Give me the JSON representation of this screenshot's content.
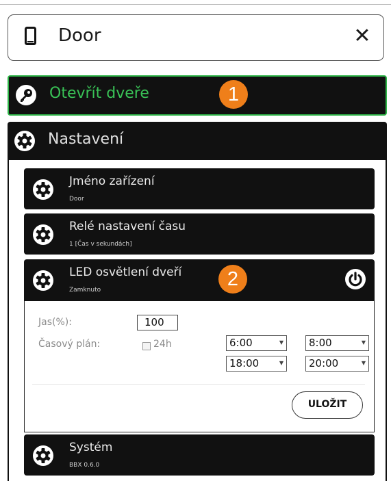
{
  "dialog": {
    "title": "Door",
    "title_icon": "phone-icon",
    "close_icon": "close-icon"
  },
  "open_door": {
    "label": "Otevřít dveře",
    "icon": "key-icon",
    "badge": "1",
    "accent": "#39c256"
  },
  "settings": {
    "label": "Nastavení",
    "items": [
      {
        "title": "Jméno zařízení",
        "subtitle": "Door"
      },
      {
        "title": "Relé nastavení času",
        "subtitle": "1 [Čas v sekundách]"
      },
      {
        "title": "LED osvětlení dveří",
        "subtitle": "Zamknuto",
        "badge": "2"
      },
      {
        "title": "Systém",
        "subtitle": "BBX 0.6.0"
      }
    ]
  },
  "led_form": {
    "brightness_label": "Jas(%):",
    "brightness_value": "100",
    "schedule_label": "Časový plán:",
    "checkbox_label": "24h",
    "from_first": "6:00",
    "to_first": "8:00",
    "from_second": "18:00",
    "to_second": "20:00",
    "save_label": "ULOŽIT"
  },
  "colors": {
    "badge": "#ef7f1a",
    "panel": "#111111",
    "green": "#2eb548"
  }
}
